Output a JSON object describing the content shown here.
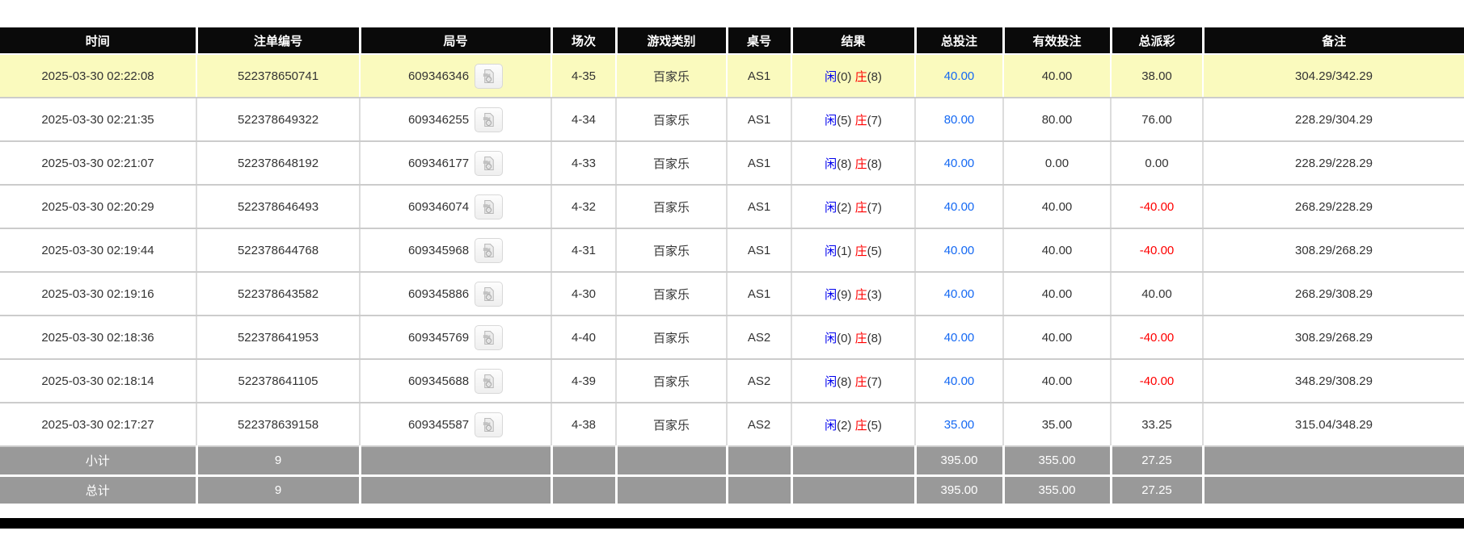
{
  "colors": {
    "header_bg": "#0a0a0a",
    "header_text": "#ffffff",
    "highlight_row_bg": "#fafabe",
    "grid_line": "#cccccc",
    "bet_link_blue": "#1569f3",
    "player_blue": "#0000ee",
    "banker_red": "#ff0000",
    "negative_red": "#ff0000",
    "summary_bg": "#999999",
    "footer_bg": "#000000"
  },
  "icons": {
    "round_media": "video-replay-icon"
  },
  "table": {
    "columns": [
      {
        "key": "time",
        "label": "时间"
      },
      {
        "key": "bet_id",
        "label": "注单编号"
      },
      {
        "key": "round_id",
        "label": "局号"
      },
      {
        "key": "session",
        "label": "场次"
      },
      {
        "key": "game_type",
        "label": "游戏类别"
      },
      {
        "key": "table_no",
        "label": "桌号"
      },
      {
        "key": "result",
        "label": "结果"
      },
      {
        "key": "total_bet",
        "label": "总投注"
      },
      {
        "key": "valid_bet",
        "label": "有效投注"
      },
      {
        "key": "total_payout",
        "label": "总派彩"
      },
      {
        "key": "remark",
        "label": "备注"
      }
    ],
    "result_labels": {
      "player": "闲",
      "banker": "庄"
    },
    "rows": [
      {
        "time": "2025-03-30 02:22:08",
        "bet_id": "522378650741",
        "round_id": "609346346",
        "session": "4-35",
        "game_type": "百家乐",
        "table_no": "AS1",
        "player": "0",
        "banker": "8",
        "total_bet": "40.00",
        "valid_bet": "40.00",
        "total_payout": "38.00",
        "remark": "304.29/342.29",
        "highlighted": true
      },
      {
        "time": "2025-03-30 02:21:35",
        "bet_id": "522378649322",
        "round_id": "609346255",
        "session": "4-34",
        "game_type": "百家乐",
        "table_no": "AS1",
        "player": "5",
        "banker": "7",
        "total_bet": "80.00",
        "valid_bet": "80.00",
        "total_payout": "76.00",
        "remark": "228.29/304.29",
        "highlighted": false
      },
      {
        "time": "2025-03-30 02:21:07",
        "bet_id": "522378648192",
        "round_id": "609346177",
        "session": "4-33",
        "game_type": "百家乐",
        "table_no": "AS1",
        "player": "8",
        "banker": "8",
        "total_bet": "40.00",
        "valid_bet": "0.00",
        "total_payout": "0.00",
        "remark": "228.29/228.29",
        "highlighted": false
      },
      {
        "time": "2025-03-30 02:20:29",
        "bet_id": "522378646493",
        "round_id": "609346074",
        "session": "4-32",
        "game_type": "百家乐",
        "table_no": "AS1",
        "player": "2",
        "banker": "7",
        "total_bet": "40.00",
        "valid_bet": "40.00",
        "total_payout": "-40.00",
        "remark": "268.29/228.29",
        "highlighted": false
      },
      {
        "time": "2025-03-30 02:19:44",
        "bet_id": "522378644768",
        "round_id": "609345968",
        "session": "4-31",
        "game_type": "百家乐",
        "table_no": "AS1",
        "player": "1",
        "banker": "5",
        "total_bet": "40.00",
        "valid_bet": "40.00",
        "total_payout": "-40.00",
        "remark": "308.29/268.29",
        "highlighted": false
      },
      {
        "time": "2025-03-30 02:19:16",
        "bet_id": "522378643582",
        "round_id": "609345886",
        "session": "4-30",
        "game_type": "百家乐",
        "table_no": "AS1",
        "player": "9",
        "banker": "3",
        "total_bet": "40.00",
        "valid_bet": "40.00",
        "total_payout": "40.00",
        "remark": "268.29/308.29",
        "highlighted": false
      },
      {
        "time": "2025-03-30 02:18:36",
        "bet_id": "522378641953",
        "round_id": "609345769",
        "session": "4-40",
        "game_type": "百家乐",
        "table_no": "AS2",
        "player": "0",
        "banker": "8",
        "total_bet": "40.00",
        "valid_bet": "40.00",
        "total_payout": "-40.00",
        "remark": "308.29/268.29",
        "highlighted": false
      },
      {
        "time": "2025-03-30 02:18:14",
        "bet_id": "522378641105",
        "round_id": "609345688",
        "session": "4-39",
        "game_type": "百家乐",
        "table_no": "AS2",
        "player": "8",
        "banker": "7",
        "total_bet": "40.00",
        "valid_bet": "40.00",
        "total_payout": "-40.00",
        "remark": "348.29/308.29",
        "highlighted": false
      },
      {
        "time": "2025-03-30 02:17:27",
        "bet_id": "522378639158",
        "round_id": "609345587",
        "session": "4-38",
        "game_type": "百家乐",
        "table_no": "AS2",
        "player": "2",
        "banker": "5",
        "total_bet": "35.00",
        "valid_bet": "35.00",
        "total_payout": "33.25",
        "remark": "315.04/348.29",
        "highlighted": false
      }
    ],
    "summary_rows": [
      {
        "name": "subtotal-row",
        "label": "小计",
        "count": "9",
        "total_bet": "395.00",
        "valid_bet": "355.00",
        "total_payout": "27.25"
      },
      {
        "name": "grandtotal-row",
        "label": "总计",
        "count": "9",
        "total_bet": "395.00",
        "valid_bet": "355.00",
        "total_payout": "27.25"
      }
    ]
  }
}
